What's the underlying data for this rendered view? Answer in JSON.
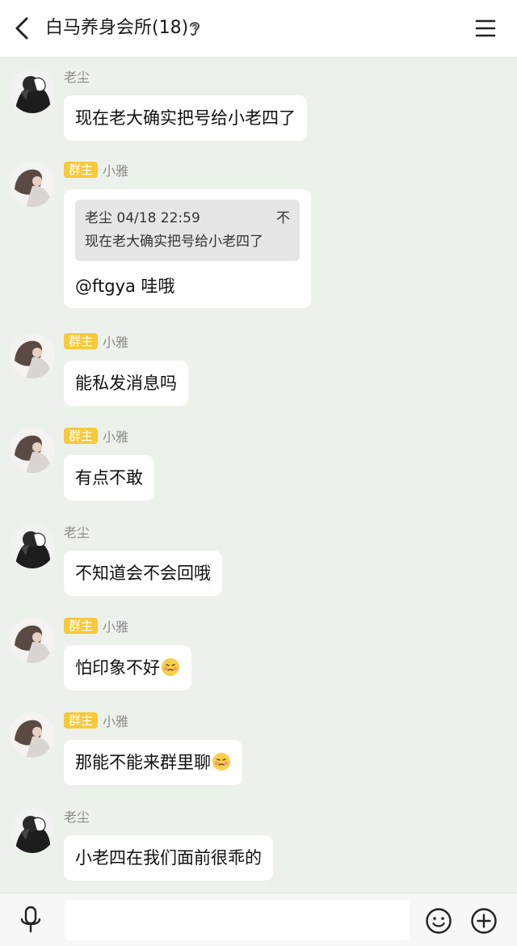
{
  "header": {
    "title": "白马养身会所(18)",
    "back_icon": "chevron-left-icon",
    "mode_icon": "ear-icon",
    "menu_icon": "hamburger-menu-icon"
  },
  "messages": [
    {
      "sender": "老尘",
      "role": "",
      "text": "现在老大确实把号给小老四了",
      "avatar": "dark"
    },
    {
      "sender": "小雅",
      "role": "群主",
      "quote": {
        "header": "老尘 04/18 22:59",
        "mark": "不",
        "body": "现在老大确实把号给小老四了"
      },
      "text": "@ftgya 哇哦",
      "avatar": "light"
    },
    {
      "sender": "小雅",
      "role": "群主",
      "text": "能私发消息吗",
      "avatar": "light"
    },
    {
      "sender": "小雅",
      "role": "群主",
      "text": "有点不敢",
      "avatar": "light"
    },
    {
      "sender": "老尘",
      "role": "",
      "text": "不知道会不会回哦",
      "avatar": "dark"
    },
    {
      "sender": "小雅",
      "role": "群主",
      "text": "怕印象不好",
      "emoji": "shy-face-emoji",
      "avatar": "light"
    },
    {
      "sender": "小雅",
      "role": "群主",
      "text": "那能不能来群里聊",
      "emoji": "shy-face-emoji",
      "avatar": "light"
    },
    {
      "sender": "老尘",
      "role": "",
      "text": "小老四在我们面前很乖的",
      "avatar": "dark"
    }
  ],
  "input": {
    "value": "",
    "mic_icon": "microphone-icon",
    "emoji_icon": "smiley-icon",
    "add_icon": "plus-circle-icon"
  },
  "colors": {
    "background": "#edf1ec",
    "bubble": "#ffffff",
    "badge": "#f7c93b",
    "quote": "#e6e6e6"
  }
}
